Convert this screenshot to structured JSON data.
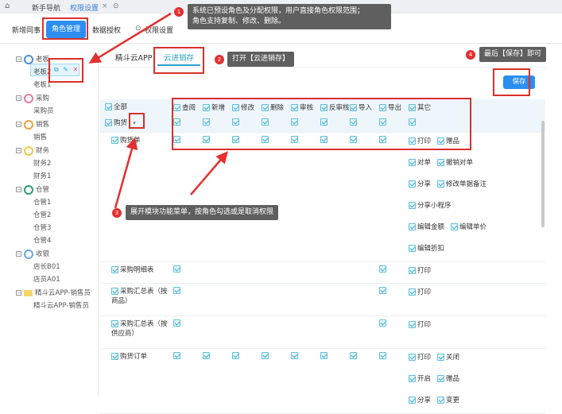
{
  "topbar": {
    "tabs": [
      "新手导航",
      "权限设置"
    ],
    "close": "×",
    "more": "⊙",
    "home": "⌂"
  },
  "subtabs": [
    "新增同事",
    "角色管理",
    "数据授权",
    "权限设置"
  ],
  "tree": {
    "groups": [
      {
        "label": "老板",
        "color": "#4a90d9",
        "children": [
          "老板2",
          "老板1"
        ]
      },
      {
        "label": "采购",
        "color": "#e57aa0",
        "children": [
          "采购员"
        ]
      },
      {
        "label": "销售",
        "color": "#f0a040",
        "children": [
          "销售"
        ]
      },
      {
        "label": "财务",
        "color": "#f2c94c",
        "children": [
          "财务2",
          "财务1"
        ]
      },
      {
        "label": "仓管",
        "color": "#2f9e6e",
        "children": [
          "仓管1",
          "仓管2",
          "仓管3",
          "仓管4"
        ]
      },
      {
        "label": "收银",
        "color": "#6aa8e8",
        "children": [
          "店长B01",
          "店员A01"
        ]
      },
      {
        "label": "精斗云APP-销售员",
        "folder": true,
        "children": [
          "精斗云APP-销售员"
        ]
      }
    ],
    "node_actions": [
      "copy",
      "edit",
      "delete"
    ]
  },
  "main_tabs": [
    "精斗云APP",
    "云进销存"
  ],
  "save_label": "保存",
  "permissions": {
    "all_label": "全部",
    "columns": [
      "查阅",
      "新增",
      "修改",
      "删除",
      "审核",
      "反审核",
      "导入",
      "导出",
      "其它"
    ],
    "rows": [
      {
        "label": "购货",
        "module": true,
        "checks": [
          0,
          1,
          2,
          3,
          4,
          5,
          6,
          7,
          8
        ],
        "extras": []
      },
      {
        "label": "购货单",
        "checks": [
          0,
          1,
          2,
          3,
          4,
          5,
          6,
          7
        ],
        "extras": [
          [
            "打印",
            "赠品"
          ],
          [
            "对单",
            "撤销对单"
          ],
          [
            "分享",
            "修改单据备注"
          ],
          [
            "分享小程序"
          ],
          [
            "编辑金额",
            "编辑单价"
          ],
          [
            "编辑折扣"
          ]
        ]
      },
      {
        "label": "采购明细表",
        "checks": [
          0,
          7
        ],
        "extras": [
          [
            "打印"
          ]
        ]
      },
      {
        "label": "采购汇总表（按商品）",
        "checks": [
          0,
          7
        ],
        "extras": [
          [
            "打印"
          ]
        ],
        "tall": true
      },
      {
        "label": "采购汇总表（按供应商）",
        "checks": [
          0,
          7
        ],
        "extras": [
          [
            "打印"
          ]
        ],
        "tall": true
      },
      {
        "label": "购货订单",
        "checks": [
          0,
          1,
          2,
          3,
          4,
          5,
          6,
          7
        ],
        "extras": [
          [
            "打印",
            "关闭"
          ],
          [
            "开启",
            "赠品"
          ],
          [
            "分享",
            "变更"
          ]
        ]
      }
    ]
  },
  "annotations": [
    {
      "num": "1",
      "text": "系统已预设角色及分配权限，用户直接角色权限范围；\n角色支持复制、修改、删除。"
    },
    {
      "num": "2",
      "text": "打开【云进销存】"
    },
    {
      "num": "3",
      "text": "展开模块功能菜单，按角色勾选或是取消权限"
    },
    {
      "num": "4",
      "text": "最后【保存】即可"
    }
  ]
}
